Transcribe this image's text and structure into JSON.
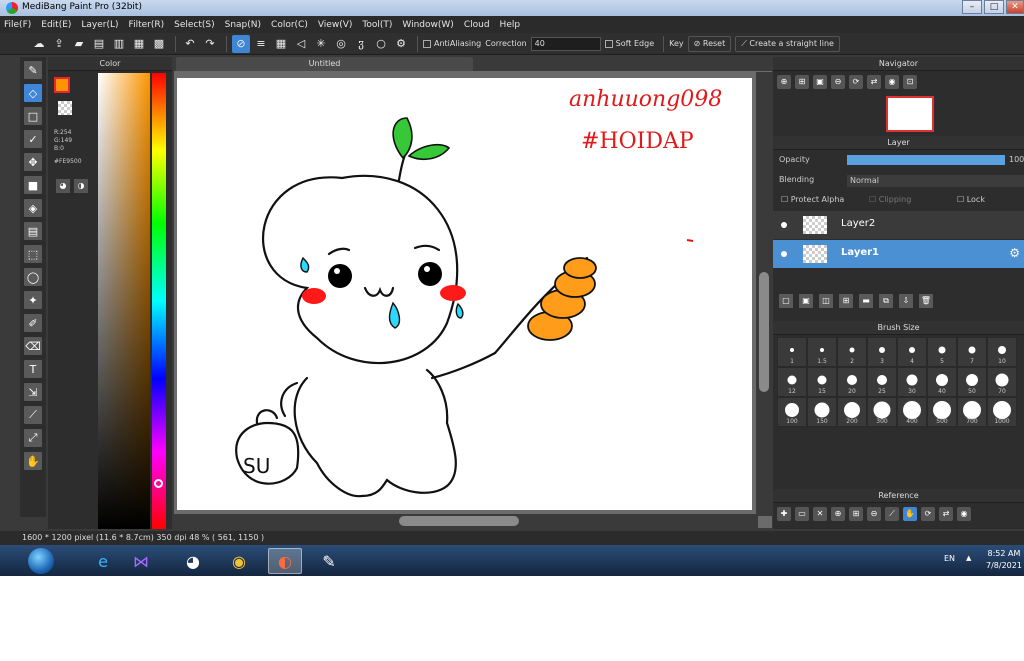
{
  "window": {
    "title": "MediBang Paint Pro (32bit)"
  },
  "menu": [
    "File(F)",
    "Edit(E)",
    "Layer(L)",
    "Filter(R)",
    "Select(S)",
    "Snap(N)",
    "Color(C)",
    "View(V)",
    "Tool(T)",
    "Window(W)",
    "Cloud",
    "Help"
  ],
  "toolbar": {
    "antialiasing_label": "AntiAliasing",
    "correction_label": "Correction",
    "correction_value": "40",
    "soft_edge_label": "Soft Edge",
    "key_label": "Key",
    "reset_label": "Reset",
    "straight_line_label": "Create a straight line"
  },
  "color_panel": {
    "title": "Color",
    "r": "R:254",
    "g": "G:149",
    "b": "B:0",
    "hex": "#FE9500",
    "current_color": "#FE9500"
  },
  "canvas": {
    "tab_title": "Untitled",
    "handwriting_line1": "anhuuong098",
    "handwriting_line2": "#HOIDAP",
    "bag_text": "SU"
  },
  "navigator": {
    "title": "Navigator"
  },
  "layer_panel": {
    "title": "Layer",
    "opacity_label": "Opacity",
    "opacity_value": "100",
    "blending_label": "Blending",
    "blending_value": "Normal",
    "protect_alpha_label": "Protect Alpha",
    "clipping_label": "Clipping",
    "lock_label": "Lock",
    "layers": [
      {
        "name": "Layer2",
        "selected": false
      },
      {
        "name": "Layer1",
        "selected": true
      }
    ]
  },
  "brush_size": {
    "title": "Brush Size",
    "sizes": [
      "1",
      "1.5",
      "2",
      "3",
      "4",
      "5",
      "7",
      "10",
      "12",
      "15",
      "20",
      "25",
      "30",
      "40",
      "50",
      "70",
      "100",
      "150",
      "200",
      "300",
      "400",
      "500",
      "700",
      "1000"
    ]
  },
  "reference": {
    "title": "Reference"
  },
  "statusbar": {
    "text": "1600 * 1200 pixel  (11.6 * 8.7cm)  350 dpi  48 %  ( 561, 1150 )"
  },
  "taskbar": {
    "language": "EN",
    "time": "8:52 AM",
    "date": "7/8/2021"
  }
}
